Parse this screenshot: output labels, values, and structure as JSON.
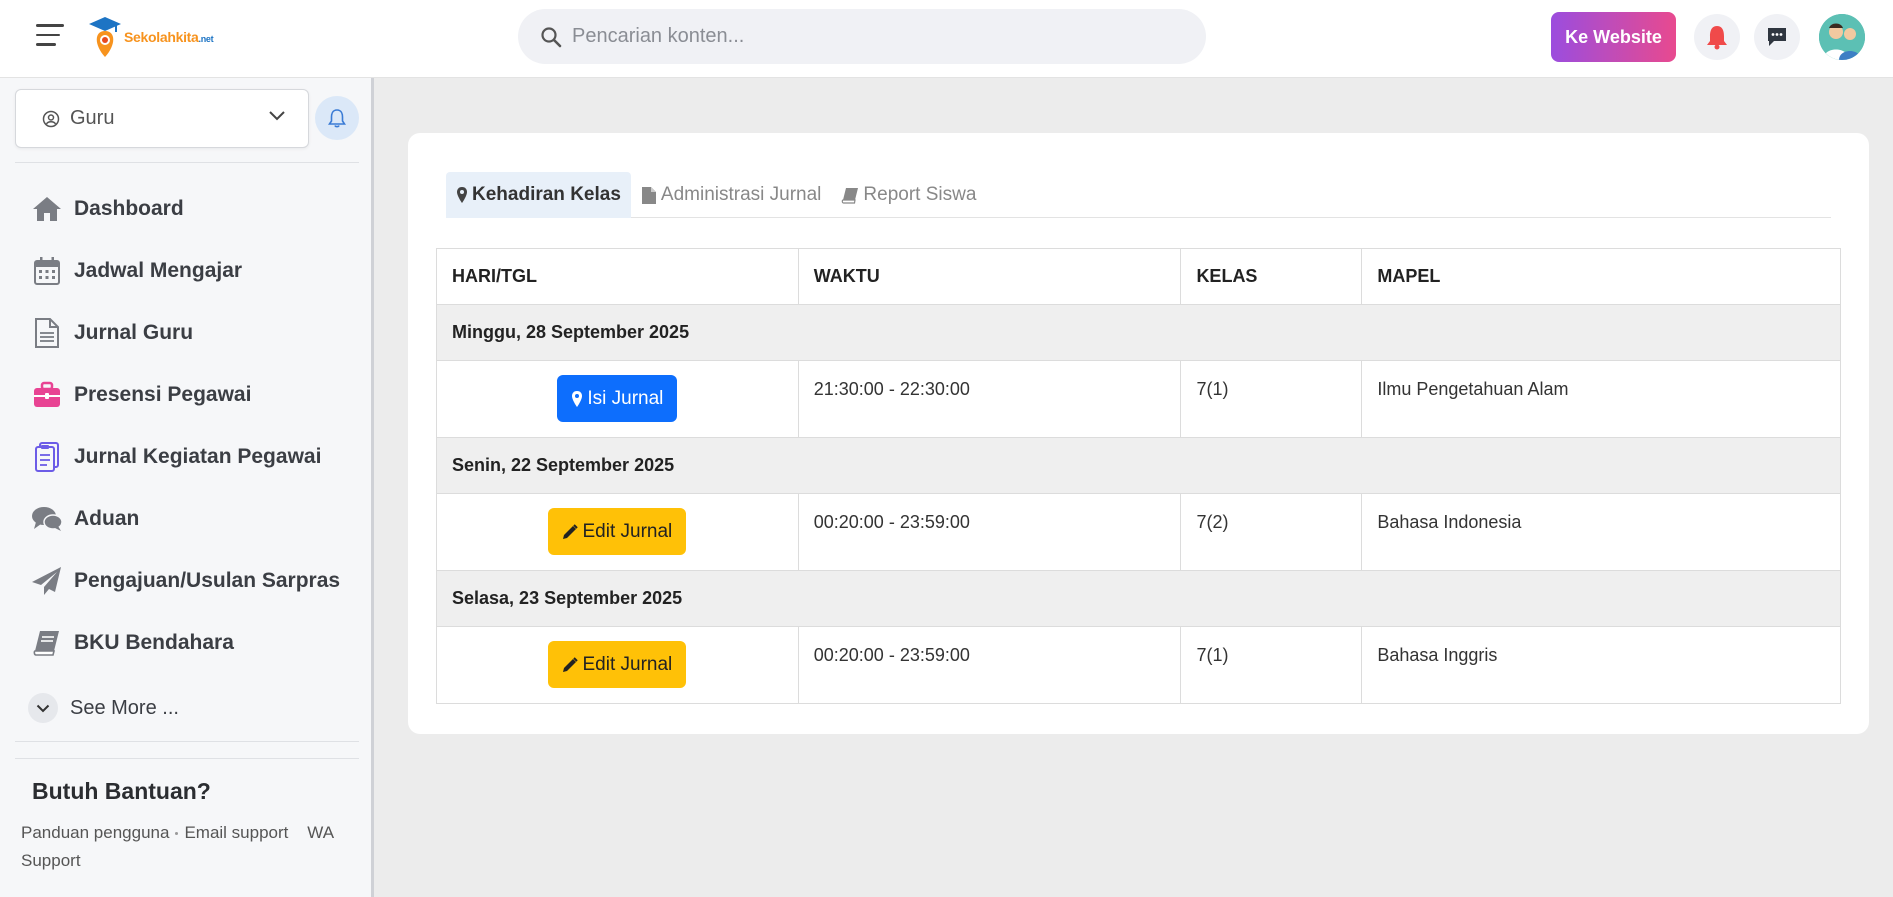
{
  "topbar": {
    "logo_text": "Sekolahkita",
    "logo_suffix": ".net",
    "search_placeholder": "Pencarian konten...",
    "website_button": "Ke Website"
  },
  "sidebar": {
    "role": "Guru",
    "items": [
      {
        "label": "Dashboard",
        "icon": "home-icon"
      },
      {
        "label": "Jadwal Mengajar",
        "icon": "calendar-icon"
      },
      {
        "label": "Jurnal Guru",
        "icon": "document-icon"
      },
      {
        "label": "Presensi Pegawai",
        "icon": "briefcase-icon"
      },
      {
        "label": "Jurnal Kegiatan Pegawai",
        "icon": "clipboard-icon"
      },
      {
        "label": "Aduan",
        "icon": "chat-icon"
      },
      {
        "label": "Pengajuan/Usulan Sarpras",
        "icon": "paper-plane-icon"
      },
      {
        "label": "BKU Bendahara",
        "icon": "book-icon"
      }
    ],
    "see_more": "See More ...",
    "help_title": "Butuh Bantuan?",
    "help_links": [
      "Panduan pengguna",
      "Email support",
      "WA Support"
    ]
  },
  "main": {
    "tabs": [
      {
        "label": "Kehadiran Kelas",
        "active": true
      },
      {
        "label": "Administrasi Jurnal",
        "active": false
      },
      {
        "label": "Report Siswa",
        "active": false
      }
    ],
    "table": {
      "headers": [
        "HARI/TGL",
        "WAKTU",
        "KELAS",
        "MAPEL"
      ],
      "groups": [
        {
          "date": "Minggu, 28 September 2025",
          "action": "Isi Jurnal",
          "time": "21:30:00 - 22:30:00",
          "class": "7(1)",
          "subject": "Ilmu Pengetahuan Alam"
        },
        {
          "date": "Senin, 22 September 2025",
          "action": "Edit Jurnal",
          "time": "00:20:00 - 23:59:00",
          "class": "7(2)",
          "subject": "Bahasa Indonesia"
        },
        {
          "date": "Selasa, 23 September 2025",
          "action": "Edit Jurnal",
          "time": "00:20:00 - 23:59:00",
          "class": "7(1)",
          "subject": "Bahasa Inggris"
        }
      ]
    }
  },
  "colors": {
    "primary": "#0d6efd",
    "warning": "#ffc107",
    "website_gradient_start": "#9b4dde",
    "website_gradient_end": "#e84a8f",
    "notification_red": "#f04a4a"
  }
}
